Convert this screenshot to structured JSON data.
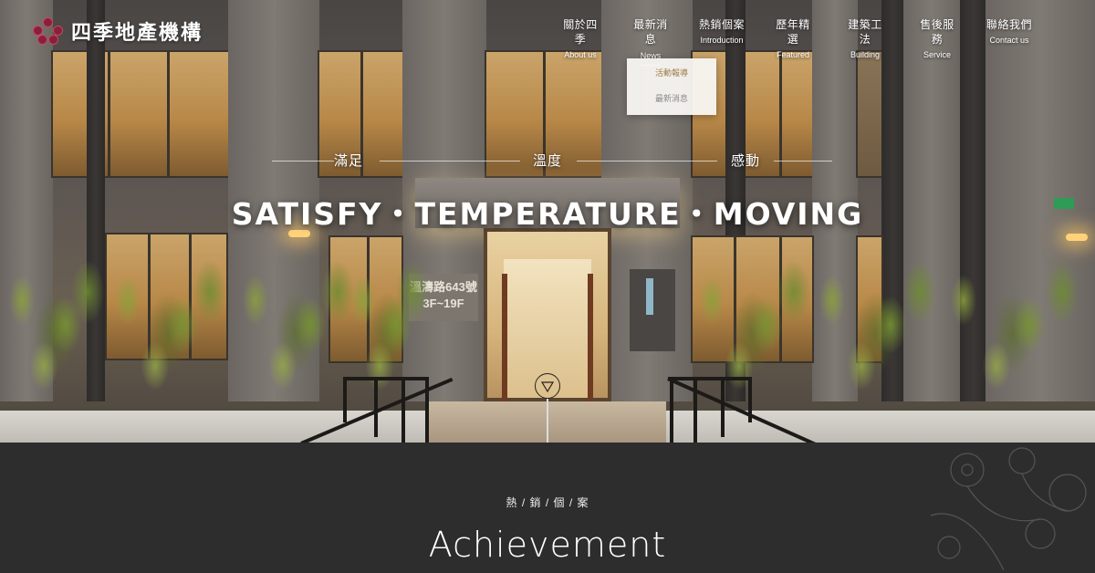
{
  "brand": {
    "name": "四季地產機構"
  },
  "nav": [
    {
      "zh": "關於四季",
      "en": "About us"
    },
    {
      "zh": "最新消息",
      "en": "News"
    },
    {
      "zh": "熱銷個案",
      "en": "Introduction"
    },
    {
      "zh": "歷年精選",
      "en": "Featured"
    },
    {
      "zh": "建築工法",
      "en": "Building"
    },
    {
      "zh": "售後服務",
      "en": "Service"
    },
    {
      "zh": "聯絡我們",
      "en": "Contact us"
    }
  ],
  "news_dropdown": {
    "items": [
      "活動報導",
      "最新消息"
    ]
  },
  "hero": {
    "taglines": [
      "滿足",
      "溫度",
      "感動"
    ],
    "headline": "SATISFY・TEMPERATURE・MOVING",
    "address_sign": [
      "溫濤路643號",
      "3F~19F"
    ]
  },
  "section": {
    "subtitle": "熱 / 銷 / 個 / 案",
    "title": "Achievement"
  },
  "colors": {
    "logo_accent": "#8a1f3a",
    "dropdown_active": "#9c7f4a",
    "footer_bg": "#2d2d2d"
  }
}
